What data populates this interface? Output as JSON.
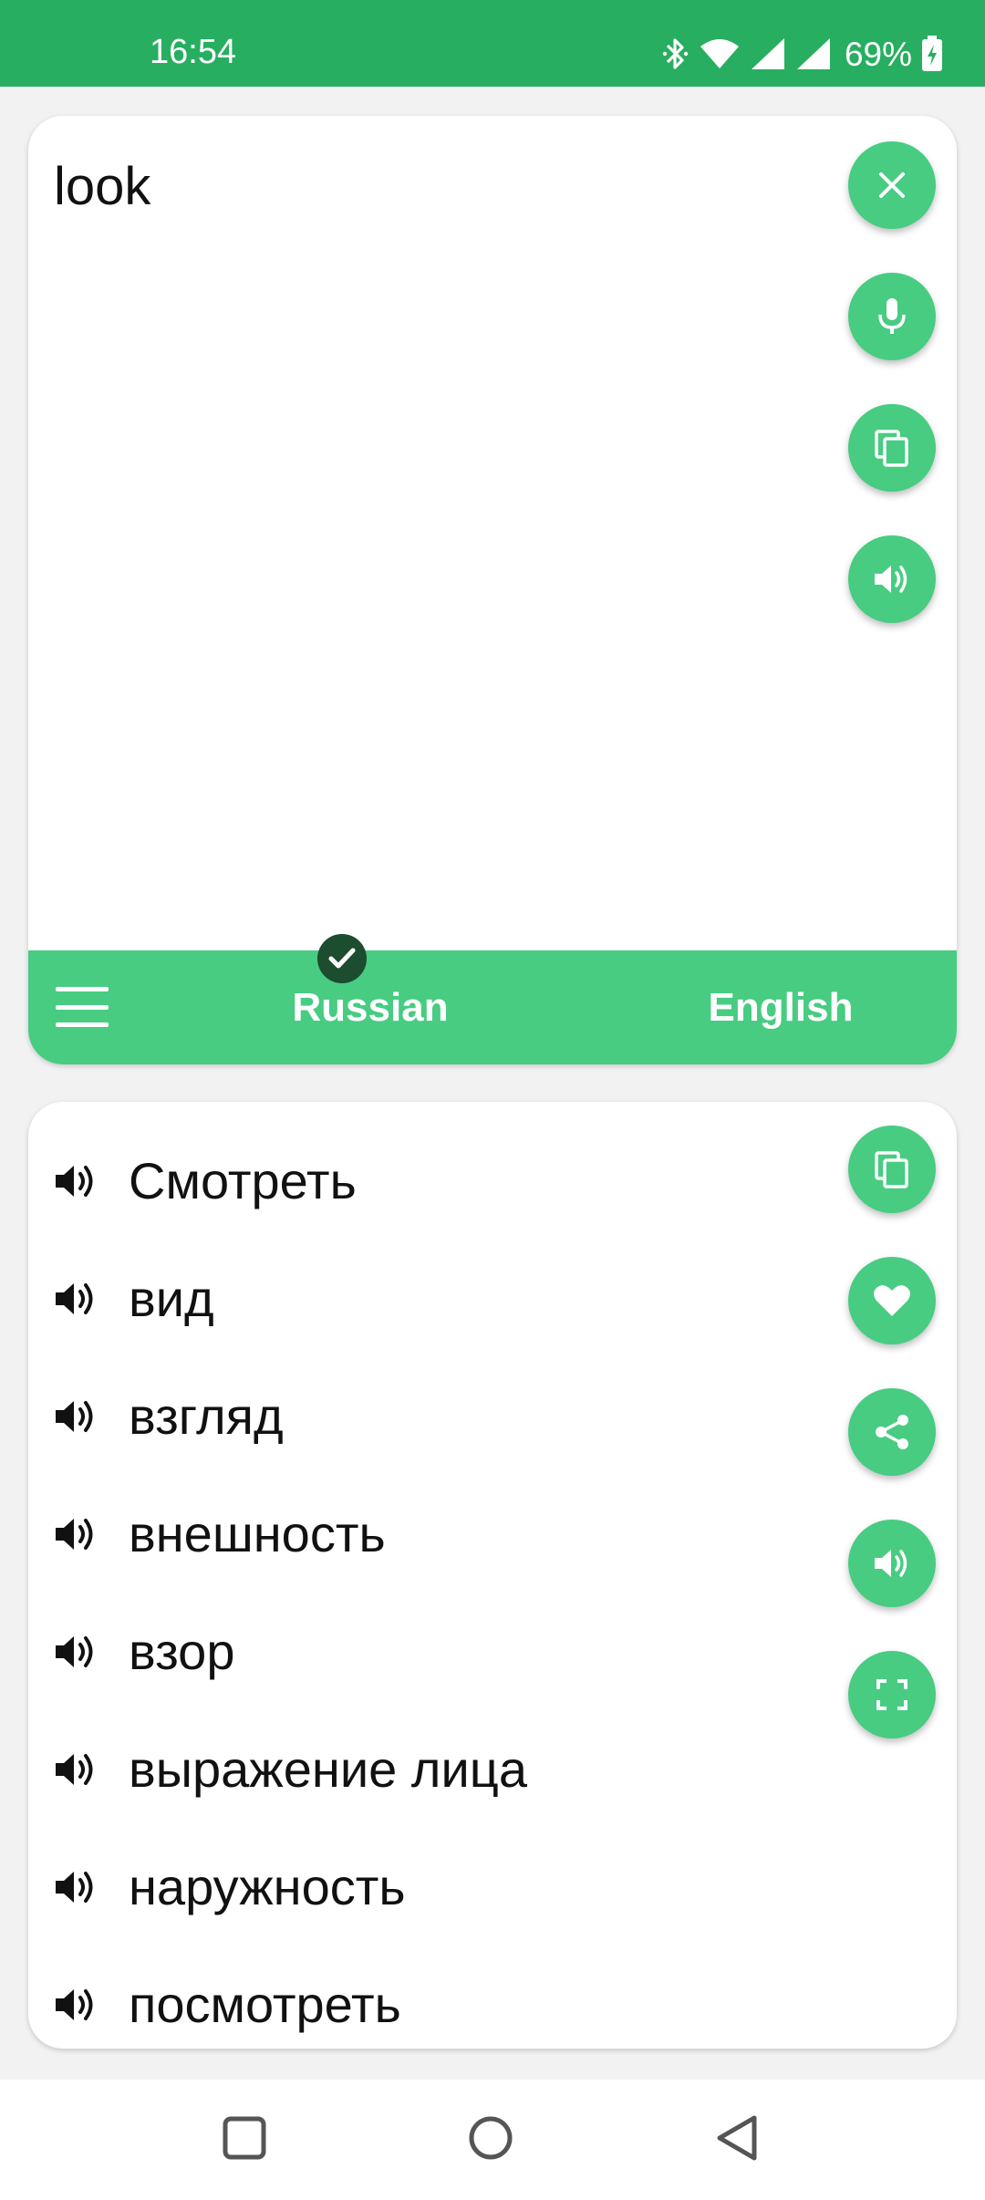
{
  "status_bar": {
    "time": "16:54",
    "battery": "69%",
    "icons": [
      "bluetooth-icon",
      "wifi-icon",
      "signal-icon",
      "signal-icon",
      "battery-charging-icon"
    ]
  },
  "colors": {
    "status_bar": "#27ae60",
    "accent": "#47cc82",
    "check_badge": "#1b4d2e"
  },
  "input": {
    "text": "look",
    "actions": [
      "close-icon",
      "microphone-icon",
      "copy-icon",
      "speaker-icon"
    ]
  },
  "language_bar": {
    "source": "Russian",
    "target": "English",
    "menu_icon": "hamburger-menu-icon"
  },
  "results": [
    "Смотреть",
    "вид",
    "взгляд",
    "внешность",
    "взор",
    "выражение лица",
    "наружность",
    "посмотреть"
  ],
  "result_actions": [
    "copy-icon",
    "heart-icon",
    "share-icon",
    "speaker-icon",
    "fullscreen-icon"
  ],
  "nav": [
    "recents-square-icon",
    "home-circle-icon",
    "back-triangle-icon"
  ]
}
